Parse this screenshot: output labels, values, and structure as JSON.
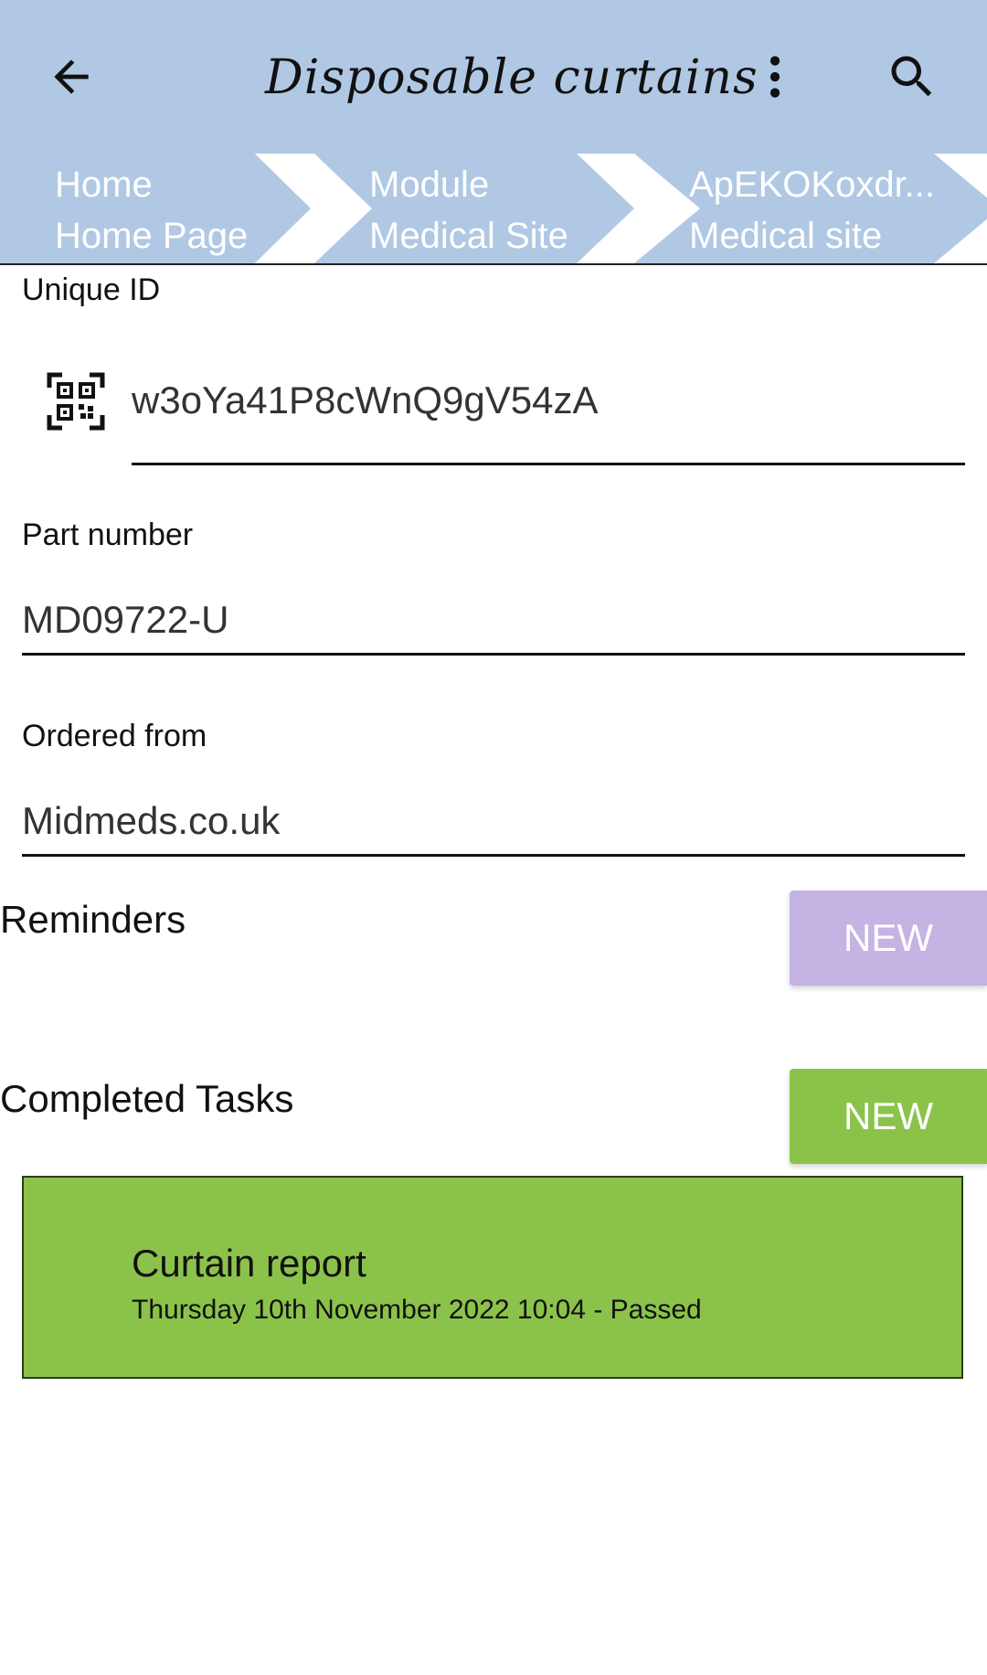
{
  "appbar": {
    "title": "Disposable curtains",
    "back_icon": "arrow-left-icon",
    "more_icon": "more-vertical-icon",
    "search_icon": "search-icon"
  },
  "breadcrumbs": [
    {
      "line1": "Home",
      "line2": "Home Page"
    },
    {
      "line1": "Module",
      "line2": "Medical Site"
    },
    {
      "line1": "ApEKOKoxdr...",
      "line2": "Medical site"
    }
  ],
  "fields": {
    "unique_id": {
      "label": "Unique ID",
      "value": "w3oYa41P8cWnQ9gV54zA",
      "icon": "qr-code-icon"
    },
    "part_number": {
      "label": "Part number",
      "value": "MD09722-U"
    },
    "ordered_from": {
      "label": "Ordered from",
      "value": "Midmeds.co.uk"
    }
  },
  "reminders": {
    "title": "Reminders",
    "new_label": "NEW",
    "button_color": "#c5b3e3"
  },
  "completed_tasks": {
    "title": "Completed Tasks",
    "new_label": "NEW",
    "button_color": "#8bc34a",
    "items": [
      {
        "title": "Curtain report",
        "subtitle": "Thursday 10th November 2022 10:04 - Passed"
      }
    ]
  },
  "colors": {
    "appbar": "#b0c8e4",
    "card": "#8bc34a"
  }
}
